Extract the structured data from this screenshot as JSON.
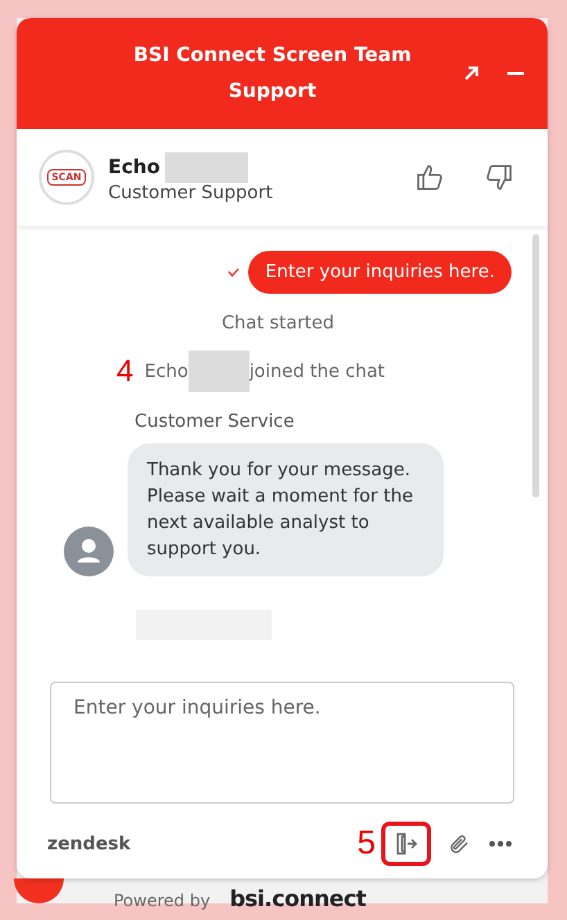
{
  "header": {
    "title": "BSI Connect Screen Team Support"
  },
  "agent": {
    "name": "Echo",
    "role": "Customer Support",
    "logo_text": "SCAN"
  },
  "messages": [
    {
      "kind": "sent",
      "text": "Enter your inquiries here.",
      "delivered": true
    },
    {
      "kind": "event",
      "text": "Chat started"
    },
    {
      "kind": "joined",
      "before": "Echo",
      "after": "joined the chat",
      "annotation": "4"
    },
    {
      "kind": "sender",
      "text": "Customer Service"
    },
    {
      "kind": "received",
      "text": "Thank you for your message. Please wait a moment for the next available analyst to support you."
    },
    {
      "kind": "skeleton"
    }
  ],
  "input": {
    "placeholder": "Enter your inquiries here."
  },
  "footer": {
    "brand": "zendesk",
    "annotation": "5"
  },
  "powered": {
    "label": "Powered by",
    "brand": "bsi.connect"
  }
}
